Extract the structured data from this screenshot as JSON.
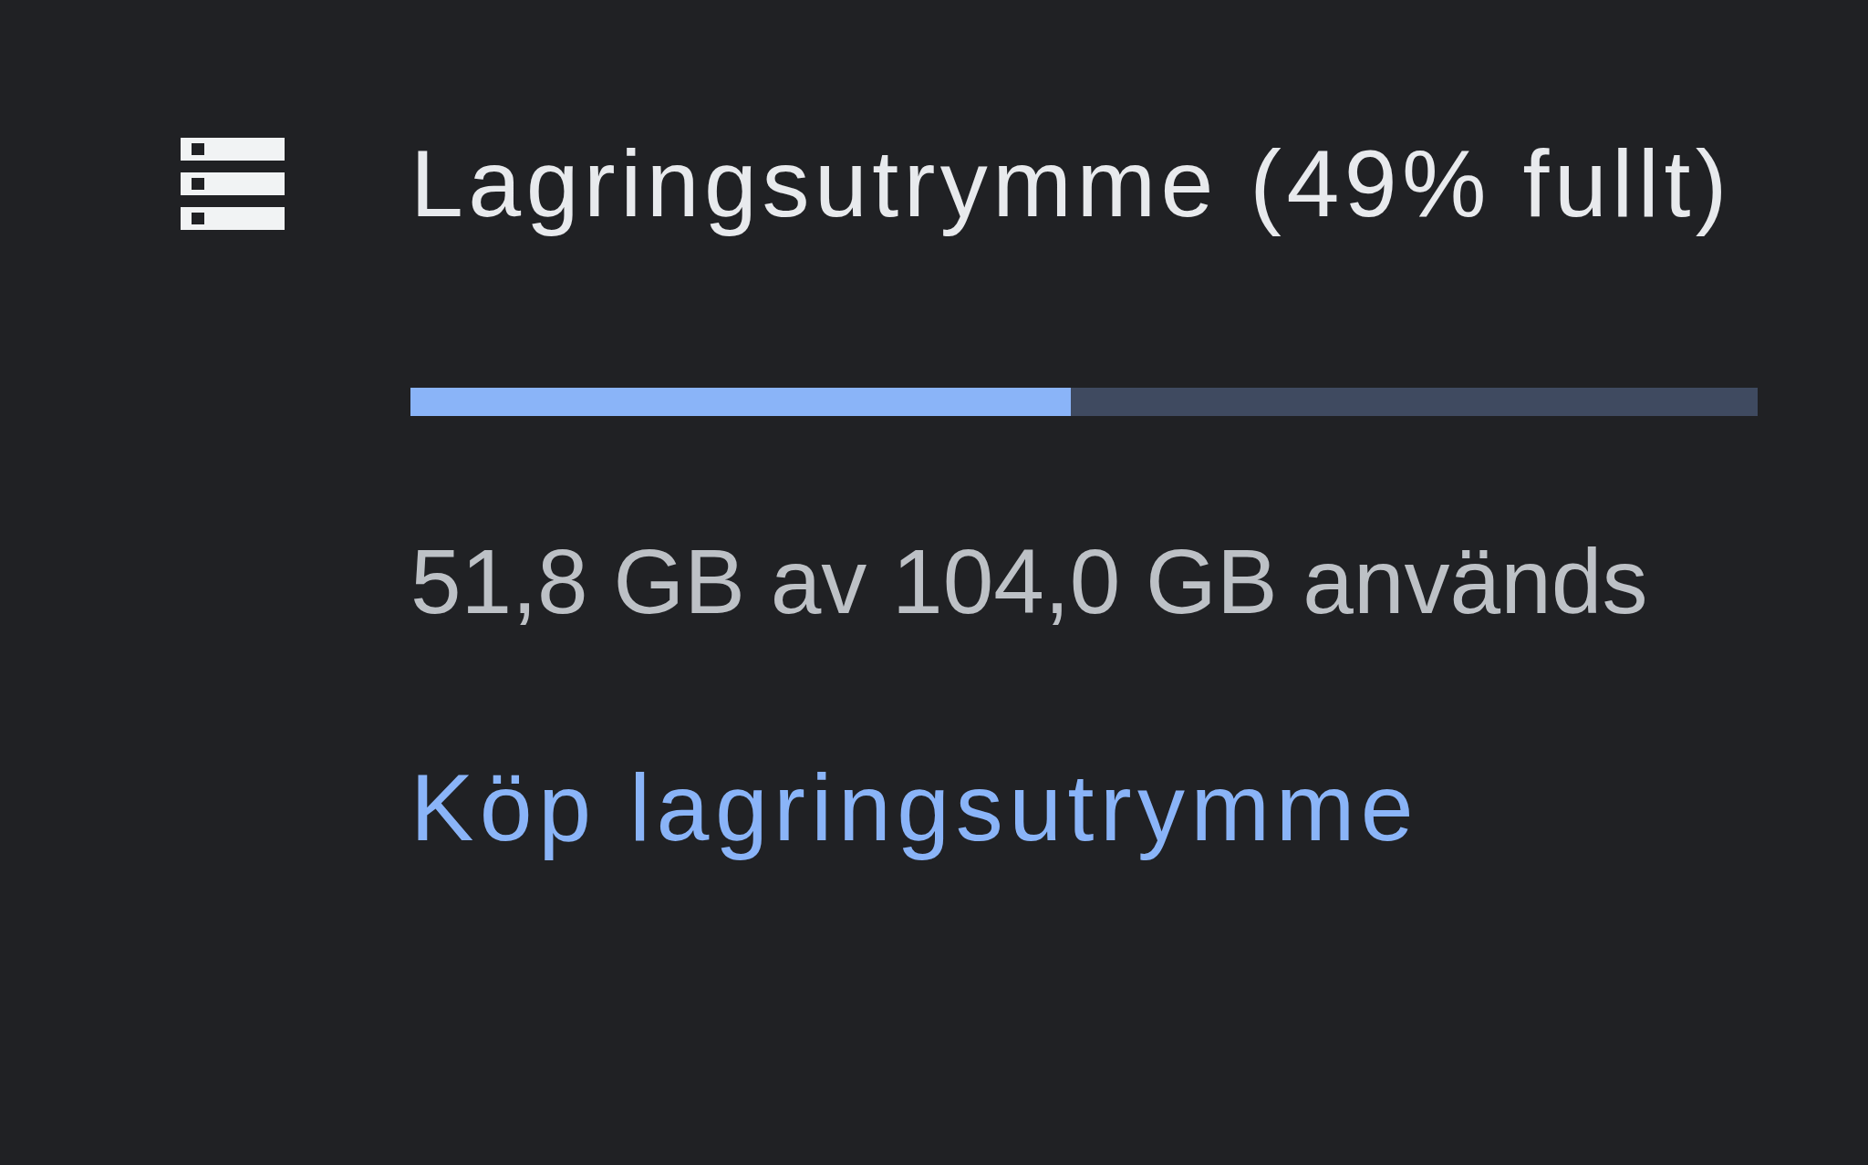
{
  "storage": {
    "title": "Lagringsutrymme (49% fullt)",
    "level": 0.49,
    "usage": "51,8 GB av 104,0 GB används",
    "buy_link": "Köp lagringsutrymme"
  }
}
